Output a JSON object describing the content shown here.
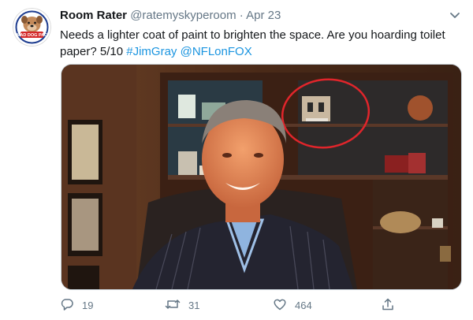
{
  "tweet": {
    "author_name": "Room Rater",
    "handle": "@ratemyskyperoom",
    "separator": "·",
    "date": "Apr 23",
    "text_main": "Needs a lighter coat of paint to brighten the space. Are you hoarding toilet paper?  5/10 ",
    "hashtag": "#JimGray",
    "mention": "@NFLonFOX",
    "avatar_badge": "MAD DOG PAC",
    "link_color": "#1b95e0"
  },
  "actions": {
    "replies": "19",
    "retweets": "31",
    "likes": "464"
  },
  "icons": [
    "profile-avatar",
    "chevron-down-icon",
    "reply-icon",
    "retweet-icon",
    "like-icon",
    "share-icon"
  ],
  "colors": {
    "text": "#14171a",
    "secondary": "#657786",
    "annotation_circle": "#e0252b"
  }
}
